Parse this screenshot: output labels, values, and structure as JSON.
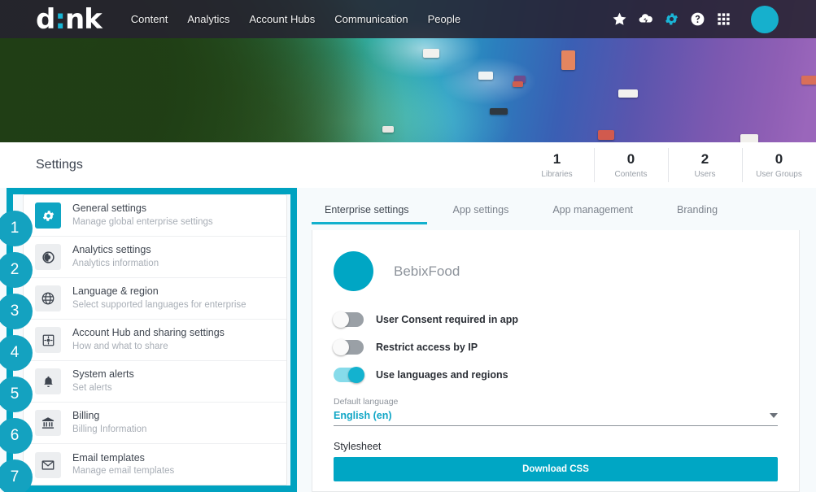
{
  "header": {
    "logo_text": "d:nk",
    "nav": [
      {
        "label": "Content"
      },
      {
        "label": "Analytics"
      },
      {
        "label": "Account Hubs"
      },
      {
        "label": "Communication"
      },
      {
        "label": "People"
      }
    ],
    "icons": [
      {
        "name": "star-icon"
      },
      {
        "name": "cloud-upload-icon"
      },
      {
        "name": "gear-icon"
      },
      {
        "name": "help-circle-icon"
      },
      {
        "name": "apps-grid-icon"
      }
    ],
    "accent_color": "#17b5d4",
    "avatar_color": "#16b0cd"
  },
  "titlebar": {
    "title": "Settings",
    "stats": [
      {
        "value": "1",
        "label": "Libraries"
      },
      {
        "value": "0",
        "label": "Contents"
      },
      {
        "value": "2",
        "label": "Users"
      },
      {
        "value": "0",
        "label": "User Groups"
      }
    ]
  },
  "annotations": {
    "badges": [
      "1",
      "2",
      "3",
      "4",
      "5",
      "6",
      "7"
    ],
    "highlight_color": "#00a2c0"
  },
  "sidebar": {
    "items": [
      {
        "title": "General settings",
        "subtitle": "Manage global enterprise settings",
        "icon": "gear-icon",
        "active": true
      },
      {
        "title": "Analytics settings",
        "subtitle": "Analytics information",
        "icon": "pie-chart-icon",
        "active": false
      },
      {
        "title": "Language & region",
        "subtitle": "Select supported languages for enterprise",
        "icon": "globe-icon",
        "active": false
      },
      {
        "title": "Account Hub and sharing settings",
        "subtitle": "How and what to share",
        "icon": "hub-share-icon",
        "active": false
      },
      {
        "title": "System alerts",
        "subtitle": "Set alerts",
        "icon": "bell-icon",
        "active": false
      },
      {
        "title": "Billing",
        "subtitle": "Billing Information",
        "icon": "bank-icon",
        "active": false
      },
      {
        "title": "Email templates",
        "subtitle": "Manage email templates",
        "icon": "envelope-icon",
        "active": false
      }
    ]
  },
  "main": {
    "tabs": [
      {
        "label": "Enterprise settings",
        "active": true
      },
      {
        "label": "App settings",
        "active": false
      },
      {
        "label": "App management",
        "active": false
      },
      {
        "label": "Branding",
        "active": false
      }
    ],
    "organization": {
      "name": "BebixFood",
      "avatar_color": "#00a6c4"
    },
    "toggles": [
      {
        "label": "User Consent required in app",
        "on": false
      },
      {
        "label": "Restrict access by IP",
        "on": false
      },
      {
        "label": "Use languages and regions",
        "on": true
      }
    ],
    "default_language": {
      "label": "Default language",
      "value": "English (en)"
    },
    "stylesheet": {
      "label": "Stylesheet",
      "button_label": "Download CSS"
    }
  }
}
